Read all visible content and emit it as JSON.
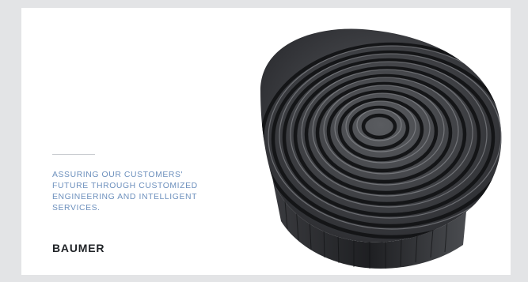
{
  "ad": {
    "tagline_lines": [
      "ASSURING OUR CUSTOMERS'",
      "FUTURE THROUGH CUSTOMIZED",
      "ENGINEERING AND INTELLIGENT",
      "SERVICES."
    ],
    "logo": "BAUMER",
    "image": "3d-fingerprint-illustration"
  },
  "colors": {
    "page_bg": "#e3e4e6",
    "card_bg": "#ffffff",
    "tagline": "#6d90bd",
    "logo": "#1f2226",
    "fingerprint_dark": "#2a2b2e",
    "fingerprint_light": "#8a8c90"
  }
}
